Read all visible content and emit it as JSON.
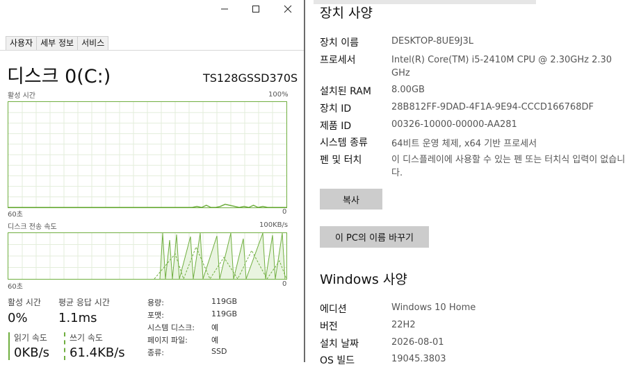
{
  "task_manager": {
    "tabs": [
      "사용자",
      "세부 정보",
      "서비스"
    ],
    "disk_title": "디스크 0(C:)",
    "disk_model": "TS128GSSD370S",
    "graph1": {
      "label": "활성 시간",
      "max": "100%",
      "left_axis": "60초",
      "right_axis": "0"
    },
    "graph2": {
      "label": "디스크 전송 속도",
      "max": "100KB/s",
      "left_axis": "60초",
      "right_axis": "0"
    },
    "stats": {
      "active_time_label": "활성 시간",
      "active_time_value": "0%",
      "response_label": "평균 응답 시간",
      "response_value": "1.1ms",
      "read_label": "읽기 속도",
      "read_value": "0KB/s",
      "write_label": "쓰기 속도",
      "write_value": "61.4KB/s"
    },
    "details": [
      {
        "key": "용량:",
        "value": "119GB"
      },
      {
        "key": "포맷:",
        "value": "119GB"
      },
      {
        "key": "시스템 디스크:",
        "value": "예"
      },
      {
        "key": "페이지 파일:",
        "value": "예"
      },
      {
        "key": "종류:",
        "value": "SSD"
      }
    ],
    "activity_series": [
      0,
      0,
      0,
      0,
      0,
      0,
      0,
      0,
      0,
      0,
      0,
      0,
      0,
      0,
      0,
      0,
      0,
      0,
      0,
      0,
      0,
      0,
      0,
      0,
      0,
      0,
      0,
      0,
      0,
      0,
      0,
      0,
      0,
      0,
      0,
      0,
      0,
      0,
      0,
      0,
      1,
      0,
      2,
      0,
      0,
      1,
      3,
      2,
      1,
      0,
      1,
      0,
      2,
      0,
      1,
      0,
      0,
      0,
      0,
      0
    ]
  },
  "settings": {
    "device_specs_title": "장치 사양",
    "device_specs": [
      {
        "key": "장치 이름",
        "value": "DESKTOP-8UE9J3L"
      },
      {
        "key": "프로세서",
        "value": "Intel(R) Core(TM) i5-2410M CPU @ 2.30GHz   2.30 GHz"
      },
      {
        "key": "설치된 RAM",
        "value": "8.00GB"
      },
      {
        "key": "장치 ID",
        "value": "28B812FF-9DAD-4F1A-9E94-CCCD166768DF"
      },
      {
        "key": "제품 ID",
        "value": "00326-10000-00000-AA281"
      },
      {
        "key": "시스템 종류",
        "value": "64비트 운영 체제, x64 기반 프로세서"
      },
      {
        "key": "펜 및 터치",
        "value": "이 디스플레이에 사용할 수 있는 펜 또는 터치식 입력이 없습니다."
      }
    ],
    "copy_button": "복사",
    "rename_button": "이 PC의 이름 바꾸기",
    "windows_specs_title": "Windows 사양",
    "windows_specs": [
      {
        "key": "에디션",
        "value": "Windows 10 Home"
      },
      {
        "key": "버전",
        "value": "22H2"
      },
      {
        "key": "설치 날짜",
        "value": "2026-08-01"
      },
      {
        "key": "OS 빌드",
        "value": "19045.3803"
      }
    ]
  },
  "colors": {
    "disk_green": "#6fae3f",
    "grid": "#e3eedb",
    "button_gray": "#cccccc"
  },
  "icons": [
    "minimize-icon",
    "maximize-icon",
    "close-icon"
  ]
}
